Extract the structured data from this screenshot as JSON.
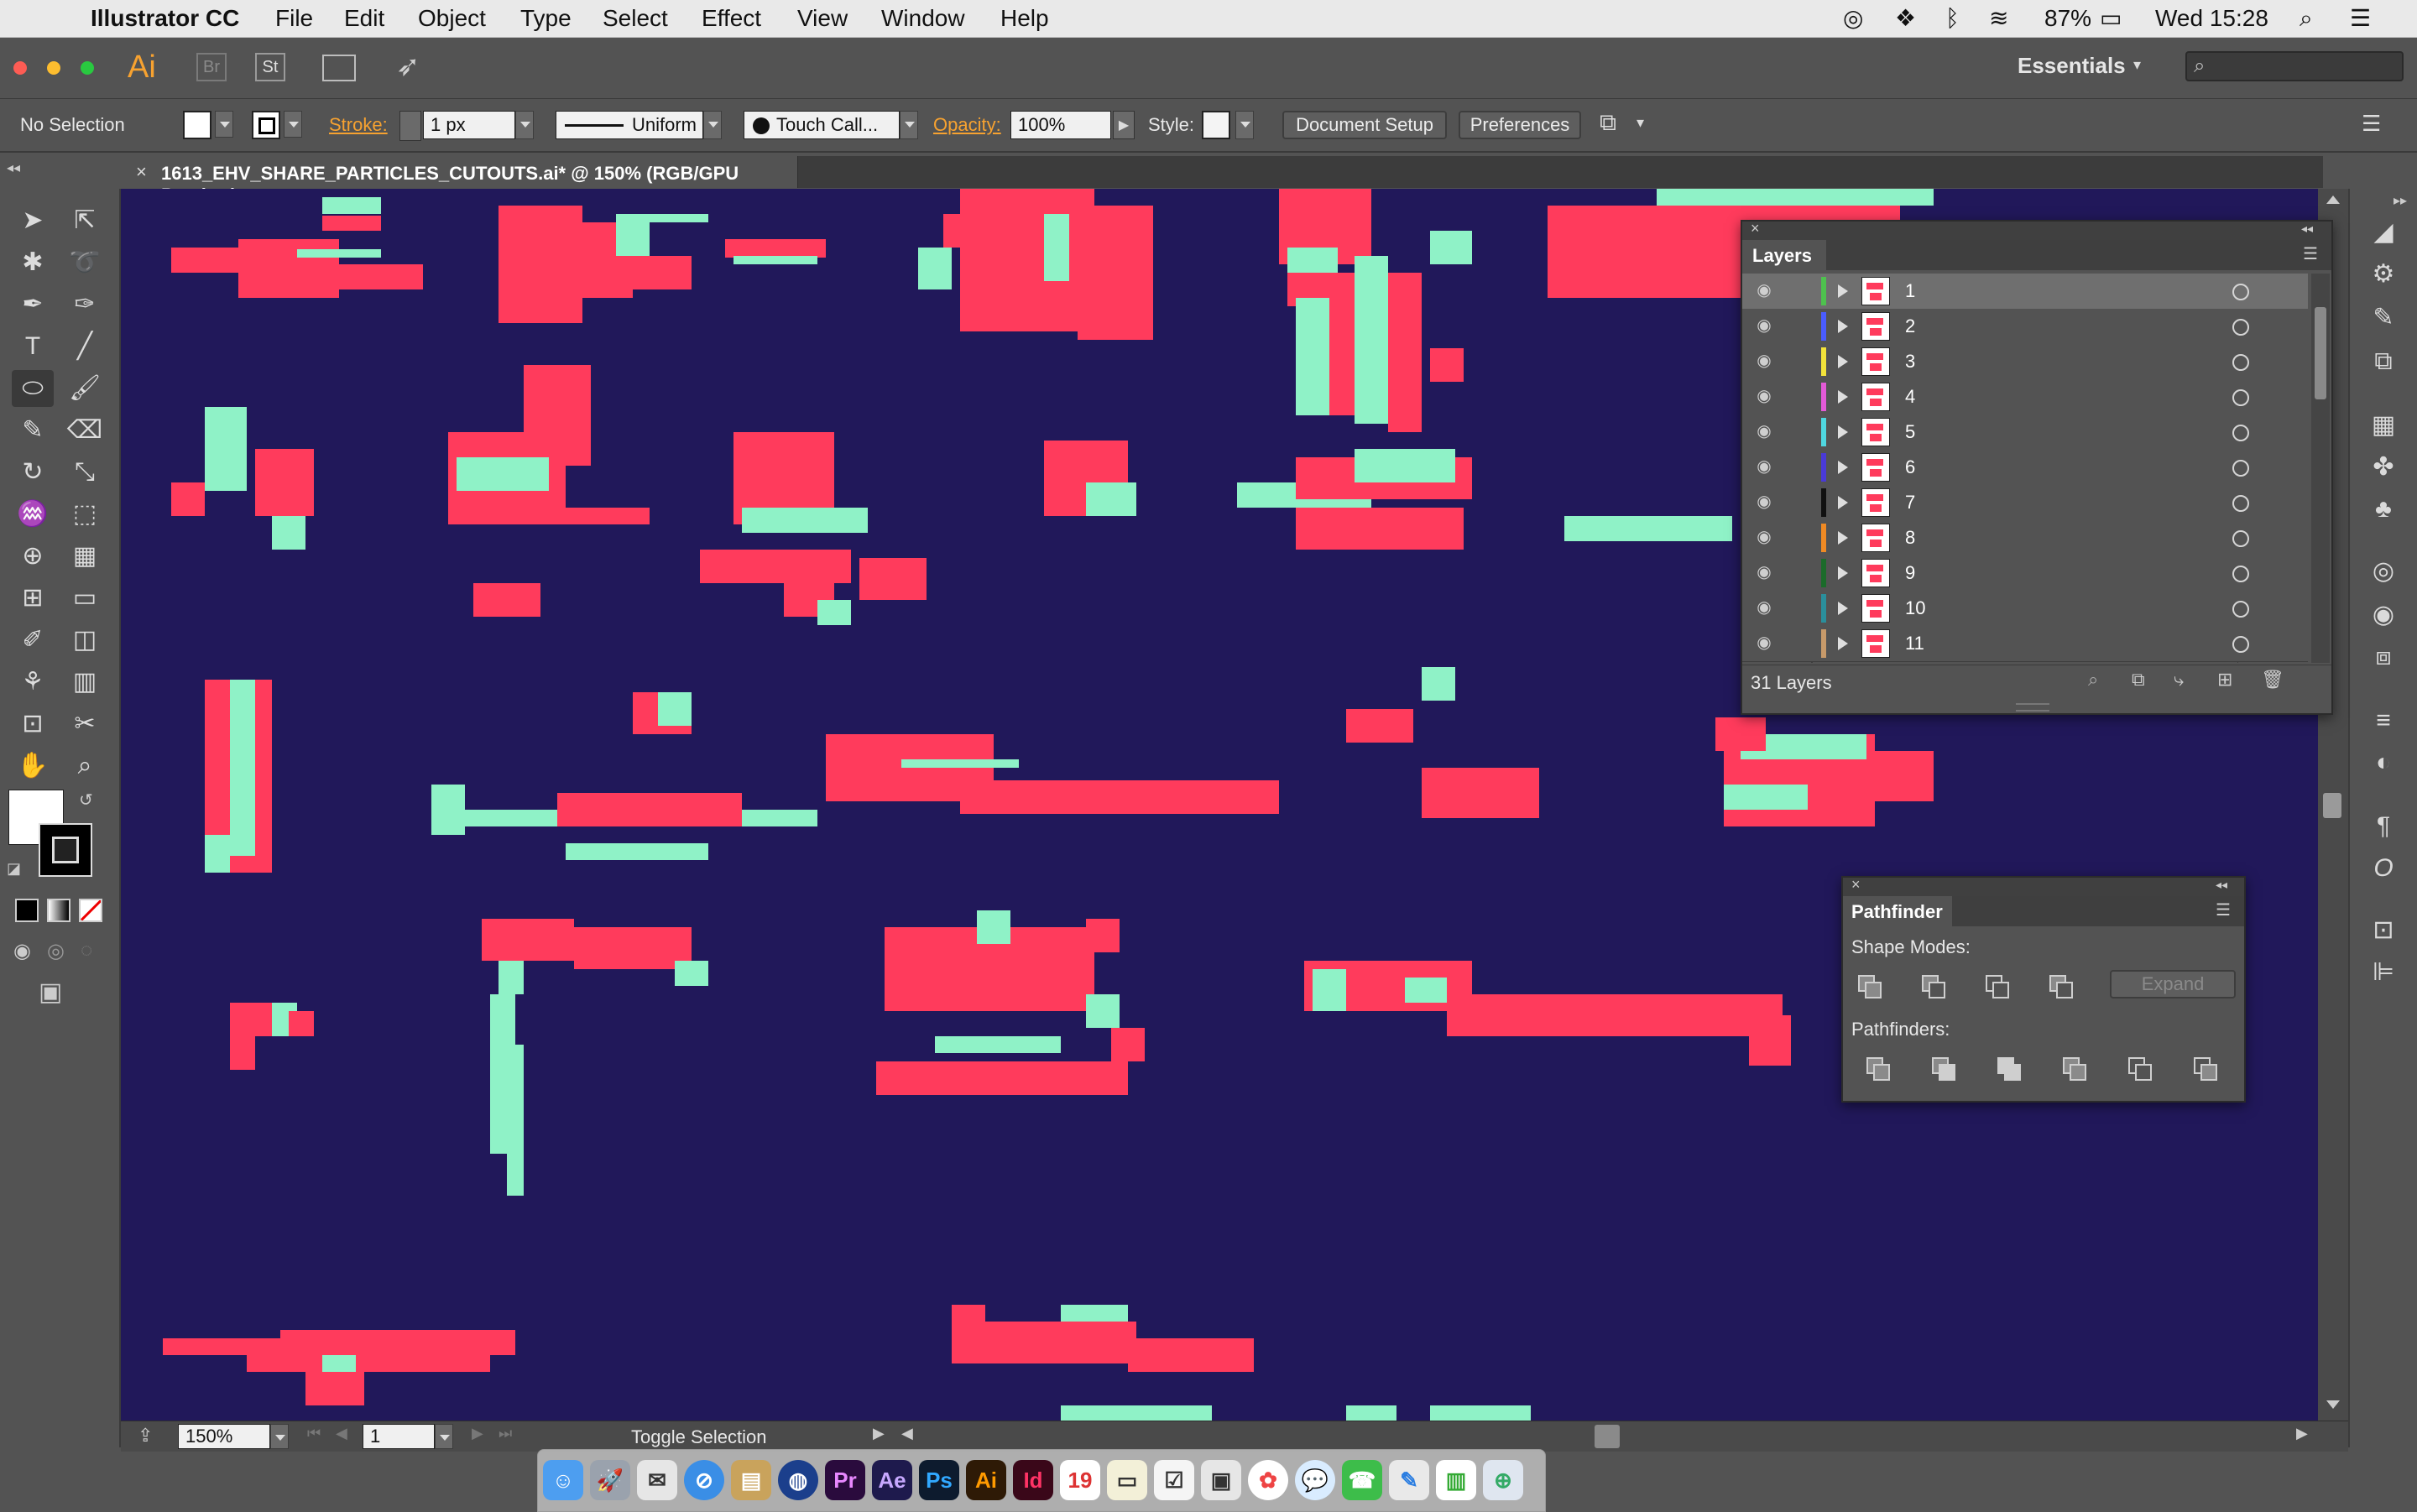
{
  "menubar": {
    "app": "Illustrator CC",
    "items": [
      "File",
      "Edit",
      "Object",
      "Type",
      "Select",
      "Effect",
      "View",
      "Window",
      "Help"
    ],
    "battery": "87%",
    "clock": "Wed 15:28"
  },
  "appbar": {
    "ai_logo": "Ai",
    "bridge": "Br",
    "stock": "St",
    "workspace": "Essentials"
  },
  "control": {
    "selection": "No Selection",
    "stroke_label": "Stroke:",
    "stroke_value": "1 px",
    "stroke_profile": "Uniform",
    "brush": "Touch Call...",
    "opacity_label": "Opacity:",
    "opacity_value": "100%",
    "style_label": "Style:",
    "doc_setup": "Document Setup",
    "preferences": "Preferences"
  },
  "document": {
    "tab_title": "1613_EHV_SHARE_PARTICLES_CUTOUTS.ai* @ 150% (RGB/GPU Preview)"
  },
  "colors": {
    "canvas": "#21185a",
    "shape_red": "#ff3b5c",
    "shape_mint": "#8ff2c7"
  },
  "layers_panel": {
    "title": "Layers",
    "count": "31 Layers",
    "layers": [
      {
        "name": "1",
        "color": "#4ec24e"
      },
      {
        "name": "2",
        "color": "#4a5cff"
      },
      {
        "name": "3",
        "color": "#f3e33a"
      },
      {
        "name": "4",
        "color": "#e45ad7"
      },
      {
        "name": "5",
        "color": "#4fd7e0"
      },
      {
        "name": "6",
        "color": "#4a3ad6"
      },
      {
        "name": "7",
        "color": "#111111"
      },
      {
        "name": "8",
        "color": "#f08a24"
      },
      {
        "name": "9",
        "color": "#1b6b2a"
      },
      {
        "name": "10",
        "color": "#2a8f9c"
      },
      {
        "name": "11",
        "color": "#c79a6a"
      }
    ]
  },
  "pathfinder": {
    "title": "Pathfinder",
    "shape_modes": "Shape Modes:",
    "expand": "Expand",
    "pathfinders": "Pathfinders:"
  },
  "statusbar": {
    "zoom": "150%",
    "artboard": "1",
    "status": "Toggle Selection"
  },
  "dock_apps": [
    "Pr",
    "Ae",
    "Ps",
    "Ai",
    "Id"
  ]
}
